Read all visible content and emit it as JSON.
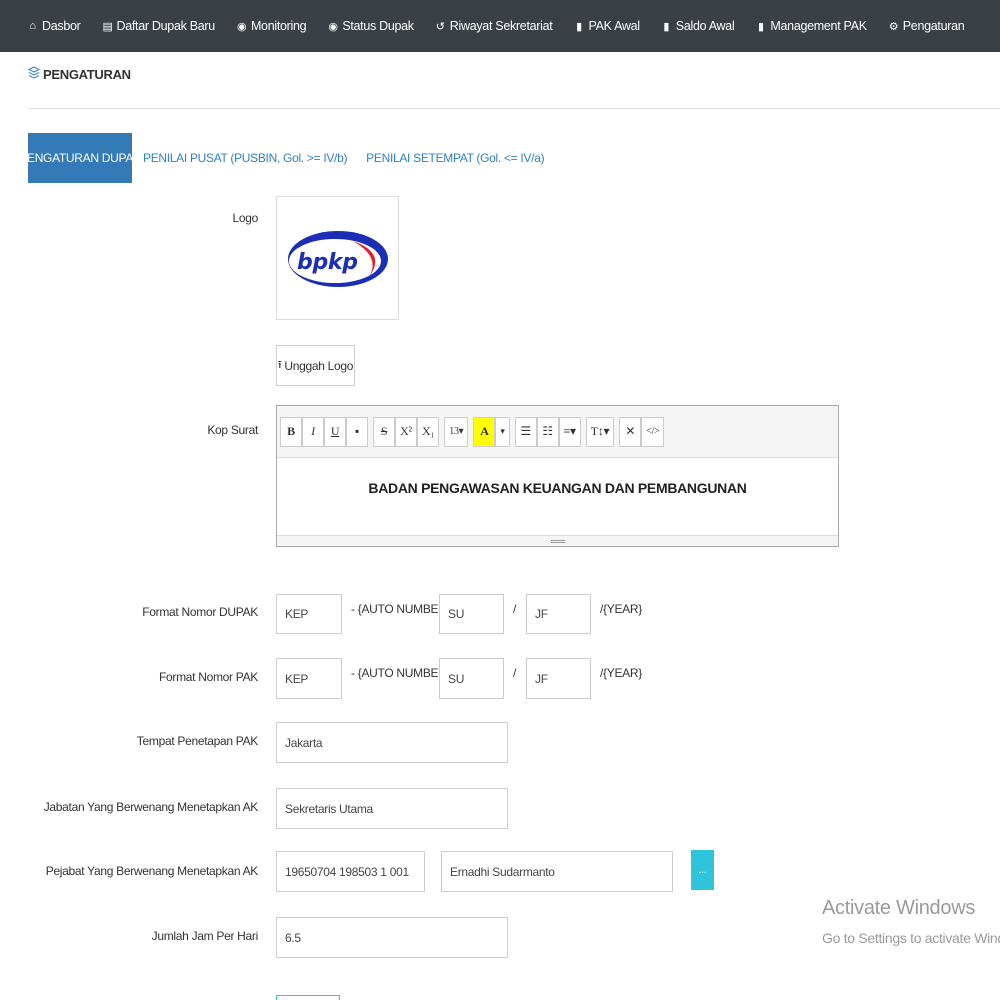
{
  "nav": [
    {
      "icon": "home-icon",
      "glyph": "⌂",
      "label": "Dasbor"
    },
    {
      "icon": "list-icon",
      "glyph": "▤",
      "label": "Daftar Dupak Baru"
    },
    {
      "icon": "eye-icon",
      "glyph": "◉",
      "label": "Monitoring"
    },
    {
      "icon": "eye-icon",
      "glyph": "◉",
      "label": "Status Dupak"
    },
    {
      "icon": "history-icon",
      "glyph": "↺",
      "label": "Riwayat Sekretariat"
    },
    {
      "icon": "file-icon",
      "glyph": "▮",
      "label": "PAK Awal"
    },
    {
      "icon": "file-icon",
      "glyph": "▮",
      "label": "Saldo Awal"
    },
    {
      "icon": "file-icon",
      "glyph": "▮",
      "label": "Management PAK"
    },
    {
      "icon": "gear-icon",
      "glyph": "⚙",
      "label": "Pengaturan"
    }
  ],
  "page": {
    "title": "PENGATURAN",
    "icon": "layers-icon"
  },
  "tabs": [
    {
      "label": "PENGATURAN DUPAK",
      "active": true
    },
    {
      "label": "PENILAI PUSAT (PUSBIN, Gol. >= IV/b)",
      "active": false
    },
    {
      "label": "PENILAI SETEMPAT (Gol. <= IV/a)",
      "active": false
    }
  ],
  "form": {
    "logo_label": "Logo",
    "logo_text": "bpkp",
    "upload_label": "Unggah Logo",
    "kop_label": "Kop Surat",
    "kop_text": "BADAN PENGAWASAN KEUANGAN DAN PEMBANGUNAN",
    "toolbar": [
      "B",
      "I",
      "U",
      "▪",
      "S",
      "X²",
      "X₁",
      "13▾",
      "A",
      "▾",
      "☰",
      "☷",
      "≡▾",
      "T↕▾",
      "✕",
      "</>"
    ],
    "dupak_label": "Format Nomor DUPAK",
    "dupak_prefix": "KEP",
    "dupak_auto": "- {AUTO NUMBER} /",
    "dupak_unit": "SU",
    "dupak_slash": "/",
    "dupak_type": "JF",
    "dupak_year": "/{YEAR}",
    "pak_label": "Format Nomor PAK",
    "pak_prefix": "KEP",
    "pak_auto": "- {AUTO NUMBER} /",
    "pak_unit": "SU",
    "pak_slash": "/",
    "pak_type": "JF",
    "pak_year": "/{YEAR}",
    "tempat_label": "Tempat Penetapan PAK",
    "tempat_value": "Jakarta",
    "jabatan_label": "Jabatan Yang Berwenang Menetapkan AK",
    "jabatan_value": "Sekretaris Utama",
    "pejabat_label": "Pejabat Yang Berwenang Menetapkan AK",
    "pejabat_nip": "19650704 198503 1 001",
    "pejabat_name": "Ernadhi Sudarmanto",
    "lookup_label": "...",
    "jam_label": "Jumlah Jam Per Hari",
    "jam_value": "6.5"
  },
  "watermark": {
    "line1": "Activate Windows",
    "line2": "Go to Settings to activate Windows."
  },
  "colors": {
    "navbar": "#3b4047",
    "active_tab": "#337ab7",
    "link": "#2f7fc1",
    "lookup_button": "#2ec4d9"
  }
}
